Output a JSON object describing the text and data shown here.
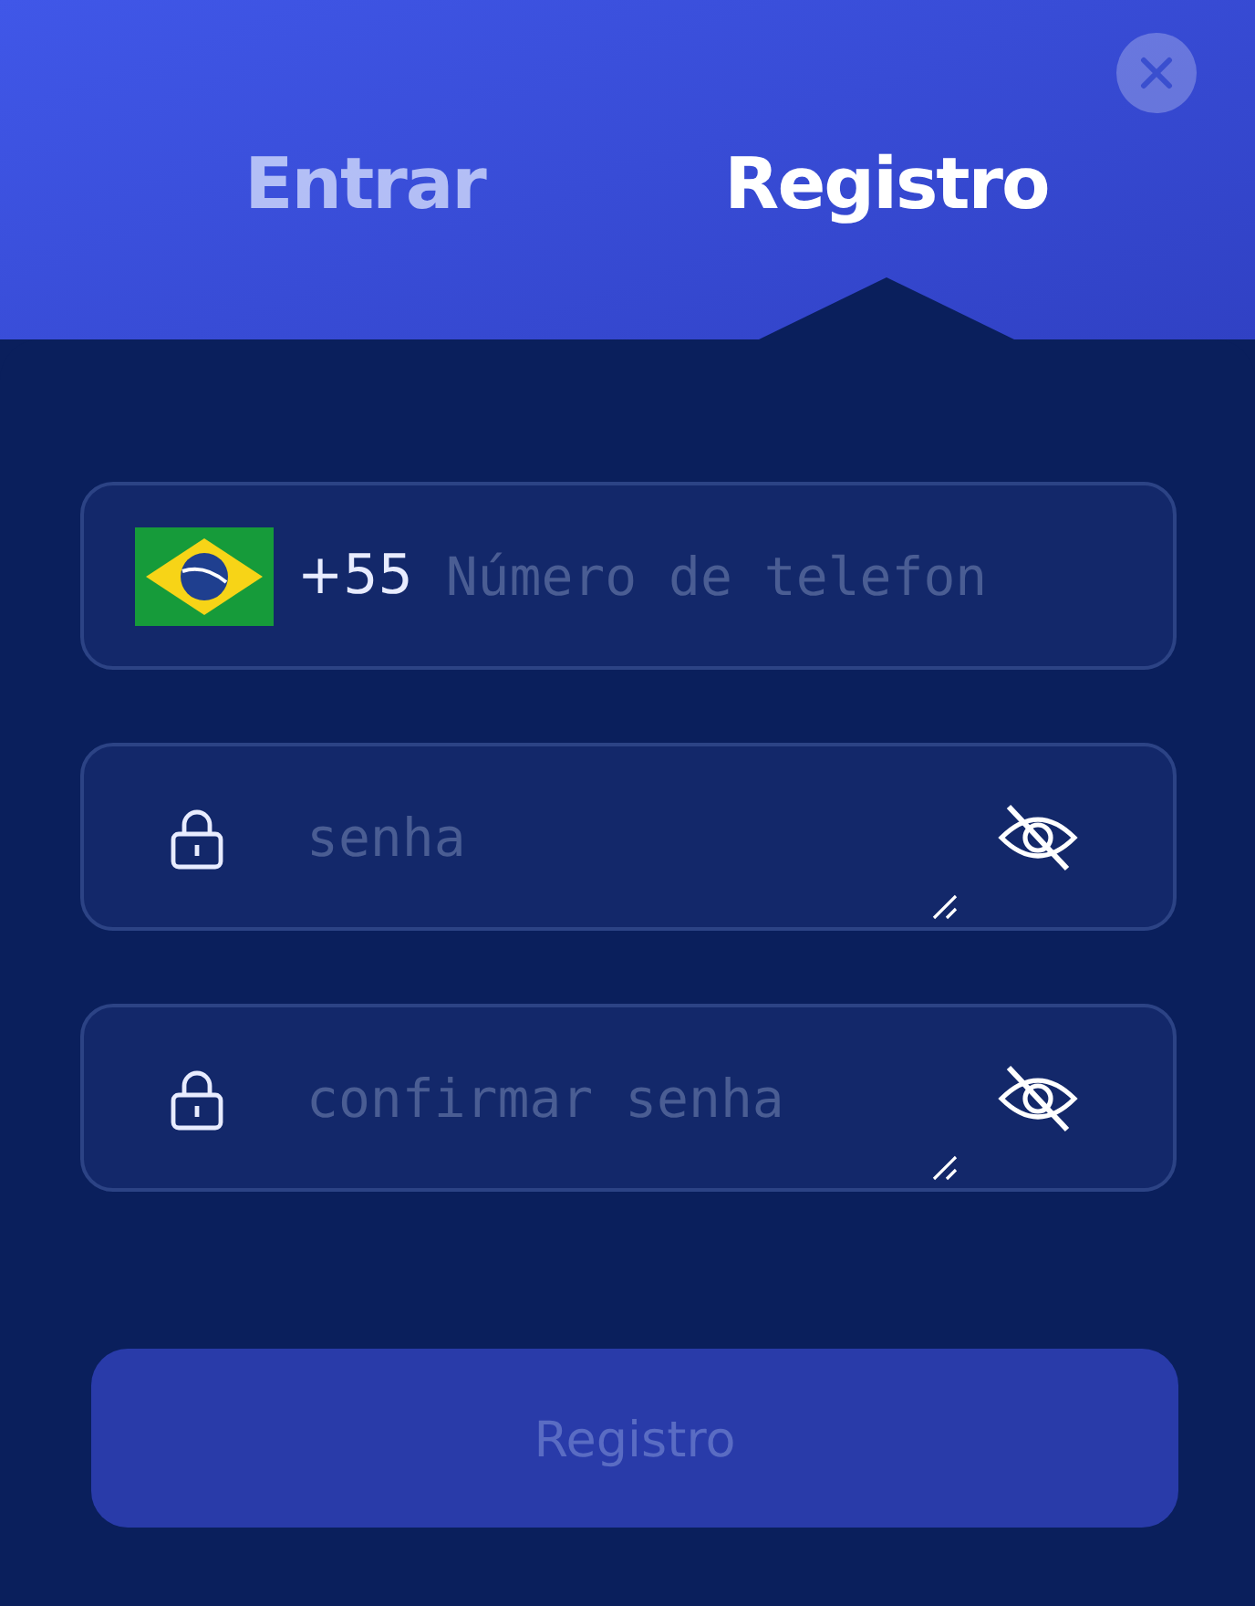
{
  "tabs": [
    {
      "label": "Entrar",
      "selected": false
    },
    {
      "label": "Registro",
      "selected": true
    }
  ],
  "fields": [
    {
      "kind": "phone",
      "prefix": "+55",
      "placeholder": "Número de telefon"
    },
    {
      "kind": "password",
      "placeholder": "senha"
    },
    {
      "kind": "password",
      "placeholder": "confirmar senha"
    }
  ],
  "submit": {
    "label": "Registro",
    "disabled": true
  }
}
